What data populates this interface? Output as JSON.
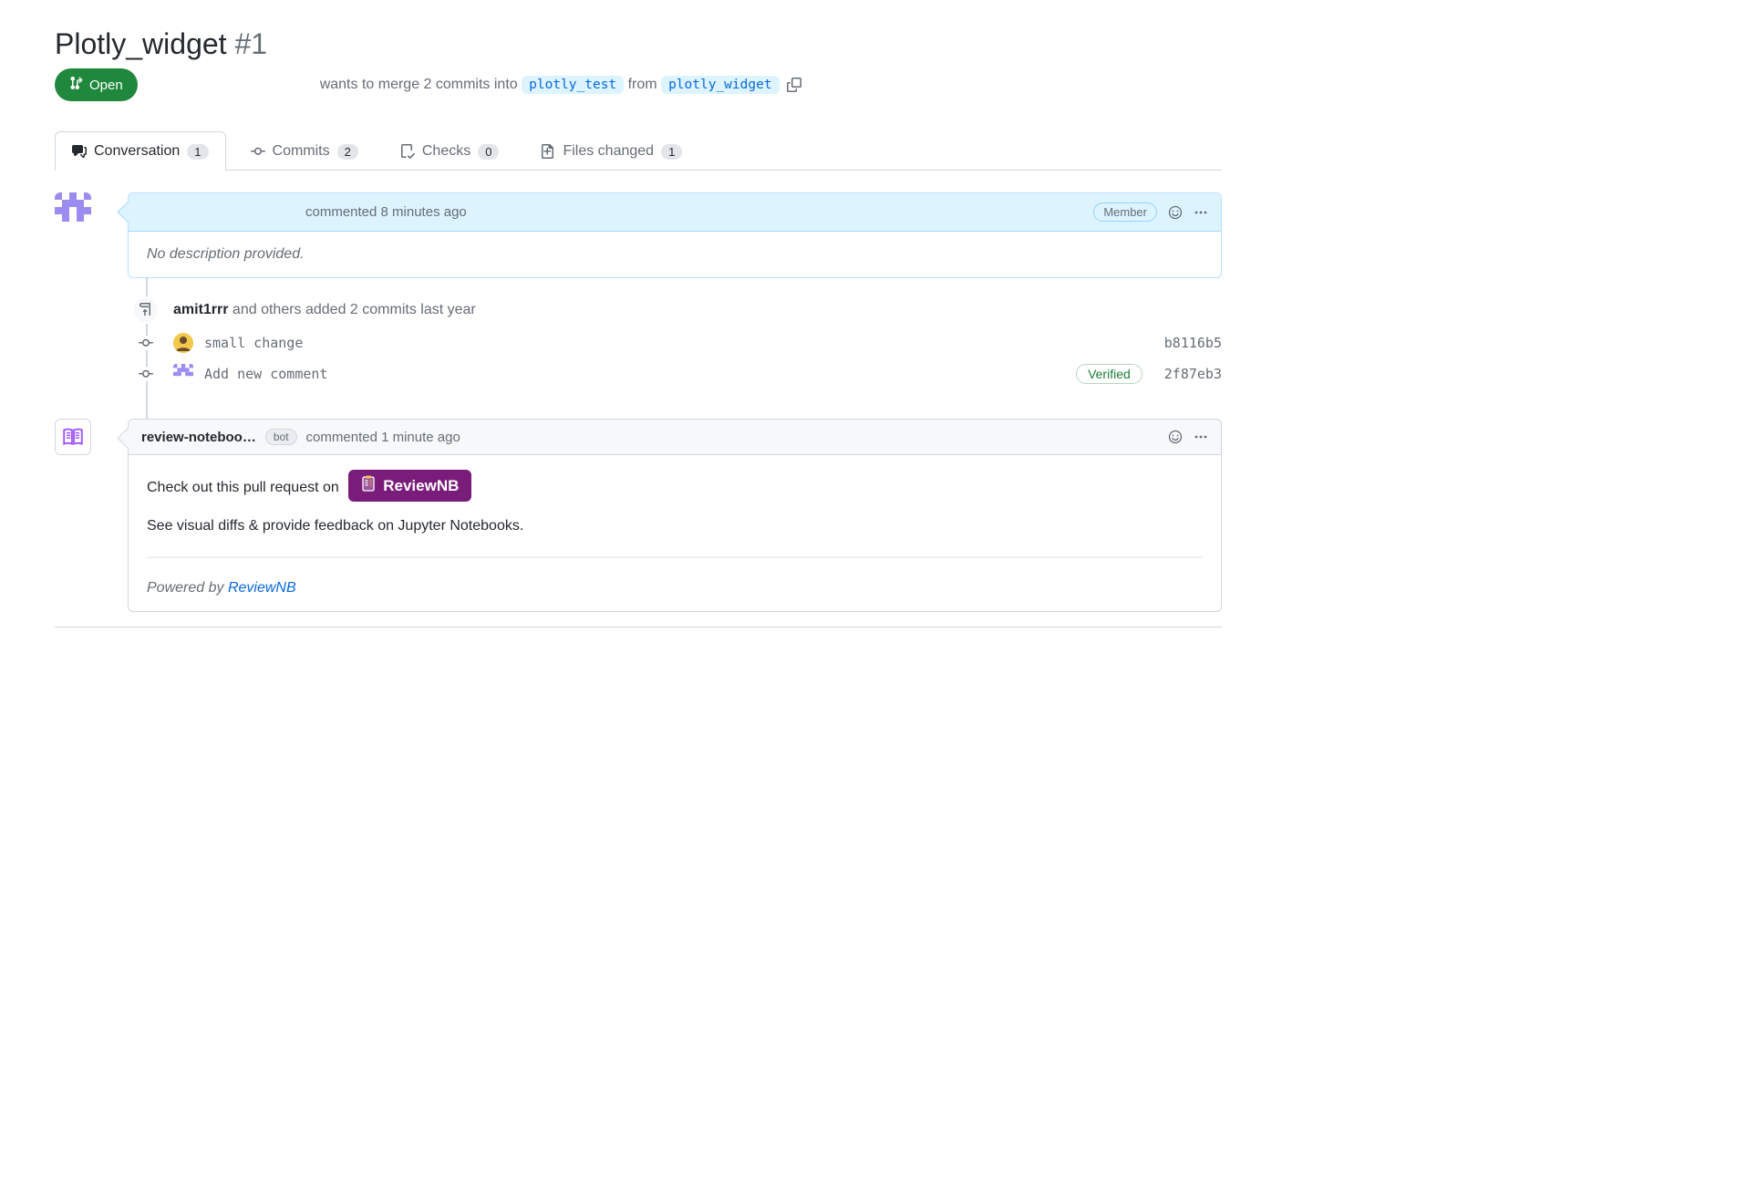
{
  "pr": {
    "title": "Plotly_widget",
    "number": "#1",
    "state_label": "Open",
    "merge_intro": "wants to merge 2 commits into",
    "base_branch": "plotly_test",
    "from_word": "from",
    "head_branch": "plotly_widget"
  },
  "tabs": {
    "conversation": {
      "label": "Conversation",
      "count": "1"
    },
    "commits": {
      "label": "Commits",
      "count": "2"
    },
    "checks": {
      "label": "Checks",
      "count": "0"
    },
    "files": {
      "label": "Files changed",
      "count": "1"
    }
  },
  "comment1": {
    "header_text": "commented 8 minutes ago",
    "role_label": "Member",
    "body": "No description provided."
  },
  "event1": {
    "author": "amit1rrr",
    "rest": " and others added 2 commits last year"
  },
  "commits": [
    {
      "msg": "small change",
      "sha": "b8116b5",
      "verified": false,
      "avatar": "yellow"
    },
    {
      "msg": "Add new comment",
      "sha": "2f87eb3",
      "verified": true,
      "avatar": "purple"
    }
  ],
  "verified_label": "Verified",
  "comment2": {
    "author": "review-noteboo…",
    "bot_label": "bot",
    "header_text": "commented 1 minute ago",
    "body_line1": "Check out this pull request on ",
    "reviewnb_btn": "ReviewNB",
    "body_line2": "See visual diffs & provide feedback on Jupyter Notebooks.",
    "powered_prefix": "Powered by ",
    "powered_link": "ReviewNB"
  }
}
